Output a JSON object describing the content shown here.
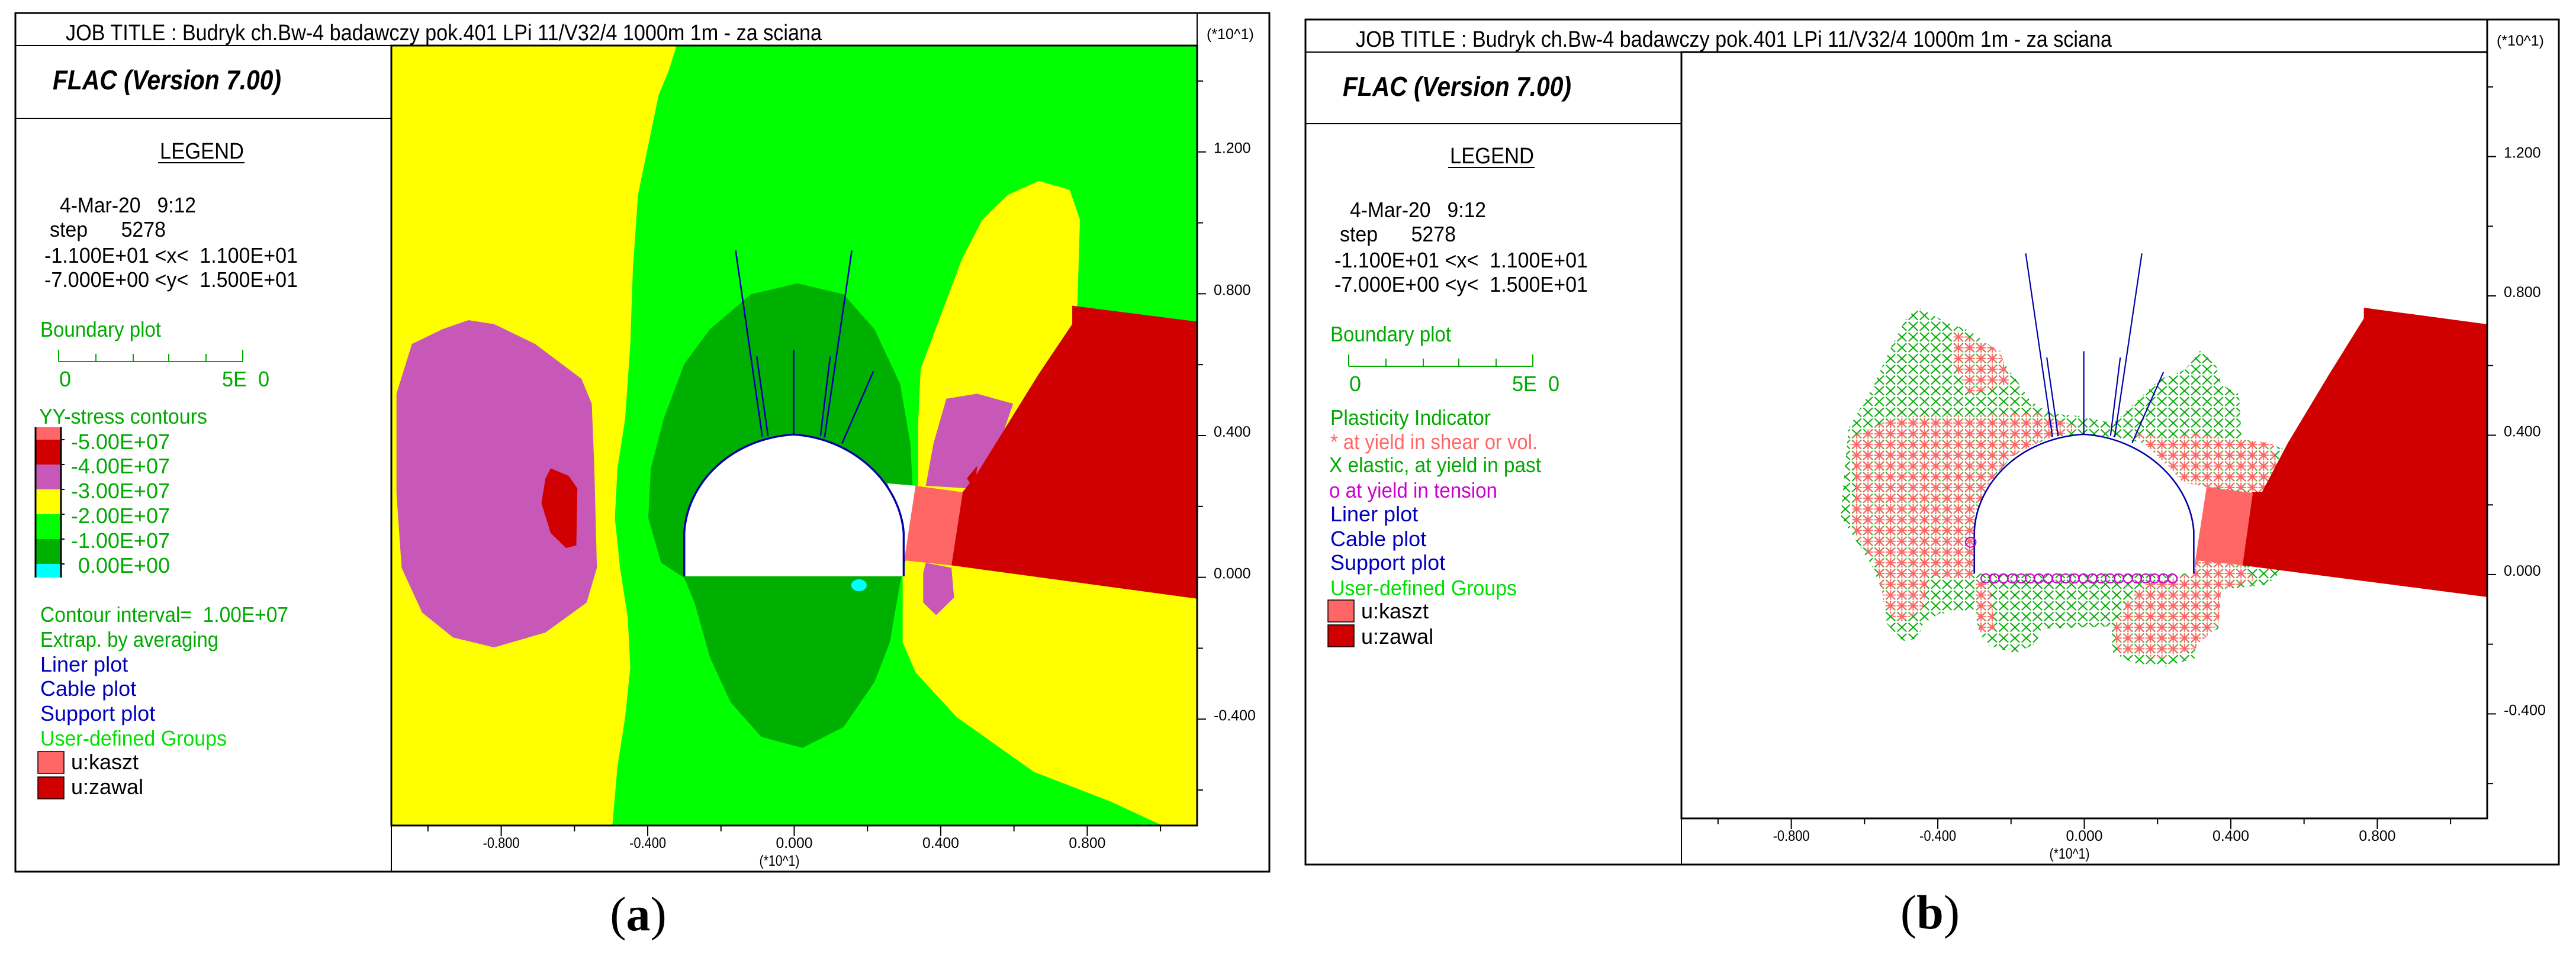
{
  "panels": [
    {
      "label_open": "(",
      "label_letter": "a",
      "label_close": ")",
      "job_title": "JOB TITLE : Budryk ch.Bw-4 badawczy pok.401 LPi 11/V32/4 1000m 1m - za sciana",
      "program": "FLAC (Version 7.00)",
      "legend_heading": "LEGEND",
      "date": "4-Mar-20   9:12",
      "step": "step      5278",
      "x_range": "-1.100E+01 <x<  1.100E+01",
      "y_range": "-7.000E+00 <y<  1.500E+01",
      "boundary_plot": "Boundary plot",
      "scale_start": "0",
      "scale_end": "5E  0",
      "contour_title": "YY-stress contours",
      "contours": [
        {
          "label": "-5.00E+07",
          "color": "#d00000"
        },
        {
          "label": "-4.00E+07",
          "color": "#c858b8"
        },
        {
          "label": "-3.00E+07",
          "color": "#ffff00"
        },
        {
          "label": "-2.00E+07",
          "color": "#00ff00"
        },
        {
          "label": "-1.00E+07",
          "color": "#00b000"
        },
        {
          "label": "0.00E+00",
          "color": "#00ffff"
        }
      ],
      "contour_top_color": "#ff6666",
      "contour_interval": "Contour interval=  1.00E+07",
      "extrap": "Extrap. by averaging",
      "liner_plot": "Liner plot",
      "cable_plot": "Cable plot",
      "support_plot": "Support plot",
      "groups_title": "User-defined Groups",
      "groups": [
        {
          "label": "u:kaszt",
          "color": "#ff6666"
        },
        {
          "label": "u:zawal",
          "color": "#d00000"
        }
      ]
    },
    {
      "label_open": "(",
      "label_letter": "b",
      "label_close": ")",
      "job_title": "JOB TITLE : Budryk ch.Bw-4 badawczy pok.401 LPi 11/V32/4 1000m 1m - za sciana",
      "program": "FLAC (Version 7.00)",
      "legend_heading": "LEGEND",
      "date": "4-Mar-20   9:12",
      "step": "step      5278",
      "x_range": "-1.100E+01 <x<  1.100E+01",
      "y_range": "-7.000E+00 <y<  1.500E+01",
      "boundary_plot": "Boundary plot",
      "scale_start": "0",
      "scale_end": "5E  0",
      "plasticity_title": "Plasticity Indicator",
      "plasticity": [
        {
          "label": "* at yield in shear or vol.",
          "color": "#ff6666"
        },
        {
          "label": "X elastic, at yield in past",
          "color": "#00aa00"
        },
        {
          "label": "o at yield in tension",
          "color": "#cc00cc"
        }
      ],
      "liner_plot": "Liner plot",
      "cable_plot": "Cable plot",
      "support_plot": "Support plot",
      "groups_title": "User-defined Groups",
      "groups": [
        {
          "label": "u:kaszt",
          "color": "#ff6666"
        },
        {
          "label": "u:zawal",
          "color": "#d00000"
        }
      ]
    }
  ],
  "axes": {
    "x_tick_labels": [
      "-0.800",
      "-0.400",
      "0.000",
      "0.400",
      "0.800"
    ],
    "y_tick_labels": [
      "1.200",
      "0.800",
      "0.400",
      "0.000",
      "-0.400"
    ],
    "multiplier": "(*10^1)"
  },
  "chart_data": [
    {
      "type": "heatmap",
      "title": "YY-stress contours",
      "xlim": [
        -1.1,
        1.1
      ],
      "ylim": [
        -0.7,
        1.5
      ],
      "x_ticks": [
        -0.8,
        -0.4,
        0.0,
        0.4,
        0.8
      ],
      "y_ticks": [
        -0.4,
        0.0,
        0.4,
        0.8,
        1.2
      ],
      "axis_multiplier": "(*10^1)",
      "contour_levels": [
        -50000000.0,
        -40000000.0,
        -30000000.0,
        -20000000.0,
        -10000000.0,
        0.0
      ],
      "contour_interval": 10000000.0,
      "legend_placement": "left"
    },
    {
      "type": "scatter",
      "title": "Plasticity Indicator",
      "xlim": [
        -1.1,
        1.1
      ],
      "ylim": [
        -0.7,
        1.5
      ],
      "x_ticks": [
        -0.8,
        -0.4,
        0.0,
        0.4,
        0.8
      ],
      "y_ticks": [
        -0.4,
        0.0,
        0.4,
        0.8,
        1.2
      ],
      "axis_multiplier": "(*10^1)",
      "series": [
        {
          "name": "* at yield in shear or vol.",
          "color": "#ff6666"
        },
        {
          "name": "X elastic, at yield in past",
          "color": "#00aa00"
        },
        {
          "name": "o at yield in tension",
          "color": "#cc00cc"
        }
      ],
      "legend_placement": "left"
    }
  ]
}
